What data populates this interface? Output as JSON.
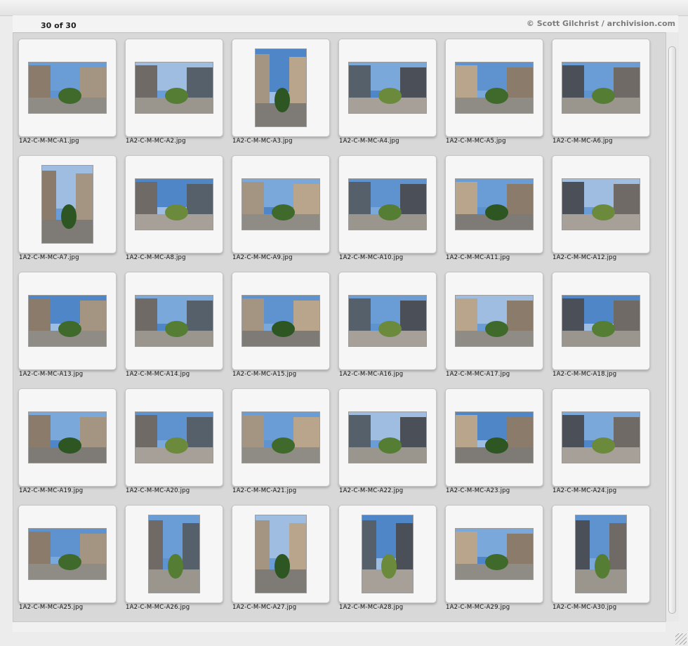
{
  "header": {
    "count_label": "30 of 30",
    "copyright": "© Scott Gilchrist / archivision.com"
  },
  "colors": {
    "sky": [
      "#5f93cf",
      "#6a9cd6",
      "#9fbde0",
      "#4f86c8",
      "#7aa8da"
    ],
    "building": [
      "#8a7b6a",
      "#6f6a66",
      "#a39582",
      "#55606b",
      "#b9a58c",
      "#4a4f58"
    ],
    "foliage": [
      "#3f6a2c",
      "#557d33",
      "#2e5623",
      "#6b8a3b"
    ],
    "ground": [
      "#8f8c86",
      "#9a958d",
      "#7e7b76",
      "#a6a099"
    ]
  },
  "thumbnails": [
    {
      "filename": "1A2-C-M-MC-A1.jpg",
      "orientation": "land"
    },
    {
      "filename": "1A2-C-M-MC-A2.jpg",
      "orientation": "land"
    },
    {
      "filename": "1A2-C-M-MC-A3.jpg",
      "orientation": "port"
    },
    {
      "filename": "1A2-C-M-MC-A4.jpg",
      "orientation": "land"
    },
    {
      "filename": "1A2-C-M-MC-A5.jpg",
      "orientation": "land"
    },
    {
      "filename": "1A2-C-M-MC-A6.jpg",
      "orientation": "land"
    },
    {
      "filename": "1A2-C-M-MC-A7.jpg",
      "orientation": "port"
    },
    {
      "filename": "1A2-C-M-MC-A8.jpg",
      "orientation": "land"
    },
    {
      "filename": "1A2-C-M-MC-A9.jpg",
      "orientation": "land"
    },
    {
      "filename": "1A2-C-M-MC-A10.jpg",
      "orientation": "land"
    },
    {
      "filename": "1A2-C-M-MC-A11.jpg",
      "orientation": "land"
    },
    {
      "filename": "1A2-C-M-MC-A12.jpg",
      "orientation": "land"
    },
    {
      "filename": "1A2-C-M-MC-A13.jpg",
      "orientation": "land"
    },
    {
      "filename": "1A2-C-M-MC-A14.jpg",
      "orientation": "land"
    },
    {
      "filename": "1A2-C-M-MC-A15.jpg",
      "orientation": "land"
    },
    {
      "filename": "1A2-C-M-MC-A16.jpg",
      "orientation": "land"
    },
    {
      "filename": "1A2-C-M-MC-A17.jpg",
      "orientation": "land"
    },
    {
      "filename": "1A2-C-M-MC-A18.jpg",
      "orientation": "land"
    },
    {
      "filename": "1A2-C-M-MC-A19.jpg",
      "orientation": "land"
    },
    {
      "filename": "1A2-C-M-MC-A20.jpg",
      "orientation": "land"
    },
    {
      "filename": "1A2-C-M-MC-A21.jpg",
      "orientation": "land"
    },
    {
      "filename": "1A2-C-M-MC-A22.jpg",
      "orientation": "land"
    },
    {
      "filename": "1A2-C-M-MC-A23.jpg",
      "orientation": "land"
    },
    {
      "filename": "1A2-C-M-MC-A24.jpg",
      "orientation": "land"
    },
    {
      "filename": "1A2-C-M-MC-A25.jpg",
      "orientation": "land"
    },
    {
      "filename": "1A2-C-M-MC-A26.jpg",
      "orientation": "port"
    },
    {
      "filename": "1A2-C-M-MC-A27.jpg",
      "orientation": "port"
    },
    {
      "filename": "1A2-C-M-MC-A28.jpg",
      "orientation": "port"
    },
    {
      "filename": "1A2-C-M-MC-A29.jpg",
      "orientation": "land"
    },
    {
      "filename": "1A2-C-M-MC-A30.jpg",
      "orientation": "port"
    }
  ]
}
